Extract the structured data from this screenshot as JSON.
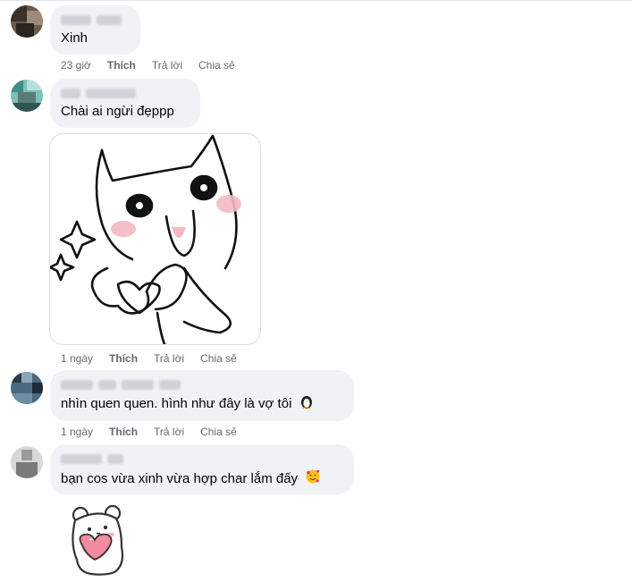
{
  "comments": [
    {
      "text": "Xinh",
      "actions": {
        "time": "23 giờ",
        "like": "Thích",
        "reply": "Trả lời",
        "share": "Chia sẻ"
      }
    },
    {
      "text": "Chài ai ngừi đẹppp",
      "actions": {
        "time": "1 ngày",
        "like": "Thích",
        "reply": "Trả lời",
        "share": "Chia sẻ"
      }
    },
    {
      "text": "nhìn quen quen. hình như đây là vợ tôi",
      "emoji": "penguin-emoji",
      "actions": {
        "time": "1 ngày",
        "like": "Thích",
        "reply": "Trả lời",
        "share": "Chia sẻ"
      }
    },
    {
      "text": "bạn cos vừa xinh vừa hợp char lắm đấy",
      "emoji": "smiling-face-with-hearts-emoji"
    }
  ],
  "colors": {
    "bubble": "#f0f2f5",
    "meta": "#65676b",
    "text": "#050505"
  }
}
